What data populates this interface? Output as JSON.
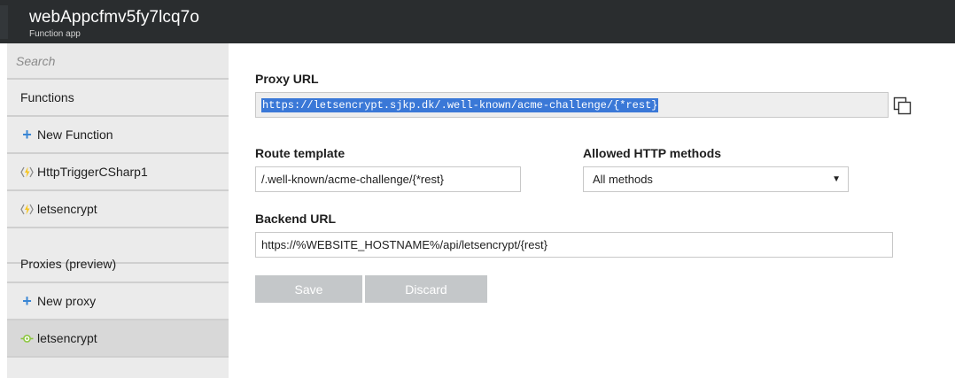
{
  "header": {
    "app_name": "webAppcfmv5fy7lcq7o",
    "app_type": "Function app"
  },
  "sidebar": {
    "search_placeholder": "Search",
    "items": [
      {
        "label": "Functions",
        "icon": "none"
      },
      {
        "label": "New Function",
        "icon": "plus-icon"
      },
      {
        "label": "HttpTriggerCSharp1",
        "icon": "function-bolt-icon"
      },
      {
        "label": "letsencrypt",
        "icon": "function-bolt-icon"
      },
      {
        "label": "Proxies (preview)",
        "icon": "none"
      },
      {
        "label": "New proxy",
        "icon": "plus-icon"
      },
      {
        "label": "letsencrypt",
        "icon": "proxy-icon",
        "selected": true
      }
    ]
  },
  "form": {
    "proxy_url_label": "Proxy URL",
    "proxy_url_value": "https://letsencrypt.sjkp.dk/.well-known/acme-challenge/{*rest}",
    "route_template_label": "Route template",
    "route_template_value": "/.well-known/acme-challenge/{*rest}",
    "allowed_methods_label": "Allowed HTTP methods",
    "allowed_methods_value": "All methods",
    "backend_url_label": "Backend URL",
    "backend_url_value": "https://%WEBSITE_HOSTNAME%/api/letsencrypt/{rest}",
    "save_label": "Save",
    "discard_label": "Discard"
  },
  "colors": {
    "header_bg": "#2a2d2f",
    "sidebar_bg": "#ebebeb",
    "accent_blue": "#3a86d4",
    "selection_blue": "#3a78d7",
    "disabled_button": "#c4c7c9",
    "proxy_green": "#8cc63f",
    "bolt_yellow": "#f7c51e"
  }
}
